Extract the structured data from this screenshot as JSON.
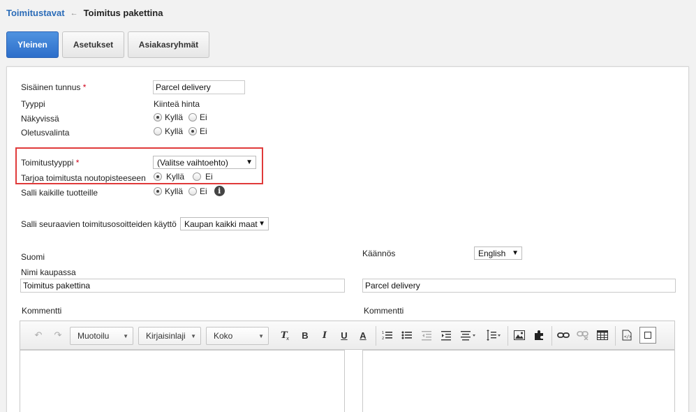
{
  "breadcrumb": {
    "parent": "Toimitustavat",
    "separator": "←",
    "current": "Toimitus pakettina"
  },
  "tabs": [
    {
      "label": "Yleinen",
      "active": true
    },
    {
      "label": "Asetukset",
      "active": false
    },
    {
      "label": "Asiakasryhmät",
      "active": false
    }
  ],
  "form": {
    "internal_id": {
      "label": "Sisäinen tunnus",
      "required_mark": "*",
      "value": "Parcel delivery"
    },
    "type": {
      "label": "Tyyppi",
      "value": "Kiinteä hinta"
    },
    "visible": {
      "label": "Näkyvissä",
      "yes": "Kyllä",
      "no": "Ei",
      "selected": "yes"
    },
    "default_choice": {
      "label": "Oletusvalinta",
      "yes": "Kyllä",
      "no": "Ei",
      "selected": "no"
    },
    "delivery_type": {
      "label": "Toimitustyyppi",
      "required_mark": "*",
      "value": "(Valitse vaihtoehto)"
    },
    "pickup_points": {
      "label": "Tarjoa toimitusta noutopisteeseen",
      "yes": "Kyllä",
      "no": "Ei",
      "selected": "yes"
    },
    "all_products": {
      "label": "Salli kaikille tuotteille",
      "yes": "Kyllä",
      "no": "Ei",
      "selected": "yes",
      "info_icon": "i"
    },
    "addresses": {
      "label": "Salli seuraavien toimitusosoitteiden käyttö",
      "value": "Kaupan kaikki maat"
    }
  },
  "language": {
    "source_lang": "Suomi",
    "translation_label": "Käännös",
    "translation_value": "English",
    "name_label": "Nimi kaupassa",
    "name_fi": "Toimitus pakettina",
    "name_en": "Parcel delivery",
    "comment_label_left": "Kommentti",
    "comment_label_right": "Kommentti"
  },
  "toolbar": {
    "format_label": "Muotoilu",
    "font_label": "Kirjaisinlaji",
    "size_label": "Koko",
    "bold": "B",
    "italic": "I",
    "underline": "U",
    "font_color": "A"
  },
  "colors": {
    "accent": "#2d6fca",
    "link": "#2b6cb8",
    "required": "#d0021b",
    "highlight_border": "#e03a3a"
  }
}
